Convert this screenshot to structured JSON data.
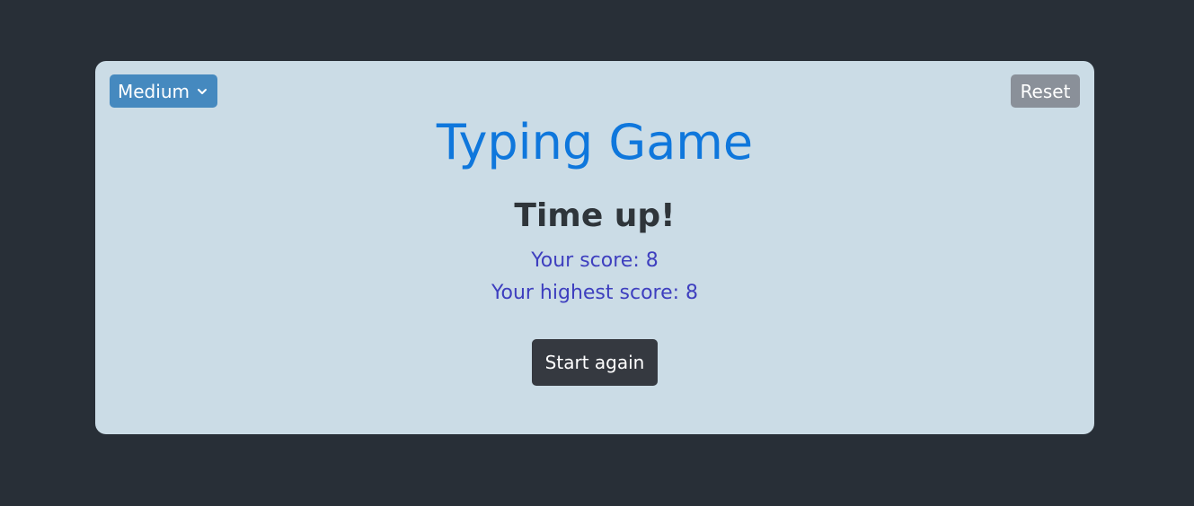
{
  "difficulty": {
    "selected": "Medium",
    "icon": "chevron-down-icon"
  },
  "reset_label": "Reset",
  "title": "Typing Game",
  "status": "Time up!",
  "score_text": "Your score: 8",
  "highest_score_text": "Your highest score: 8",
  "start_again_label": "Start again",
  "colors": {
    "background": "#282f37",
    "card": "#cbdce6",
    "title": "#0f77dc",
    "difficulty_button": "#4589bf",
    "reset_button": "#8a9099",
    "start_button": "#353940",
    "score_text": "#3e3fbf"
  }
}
